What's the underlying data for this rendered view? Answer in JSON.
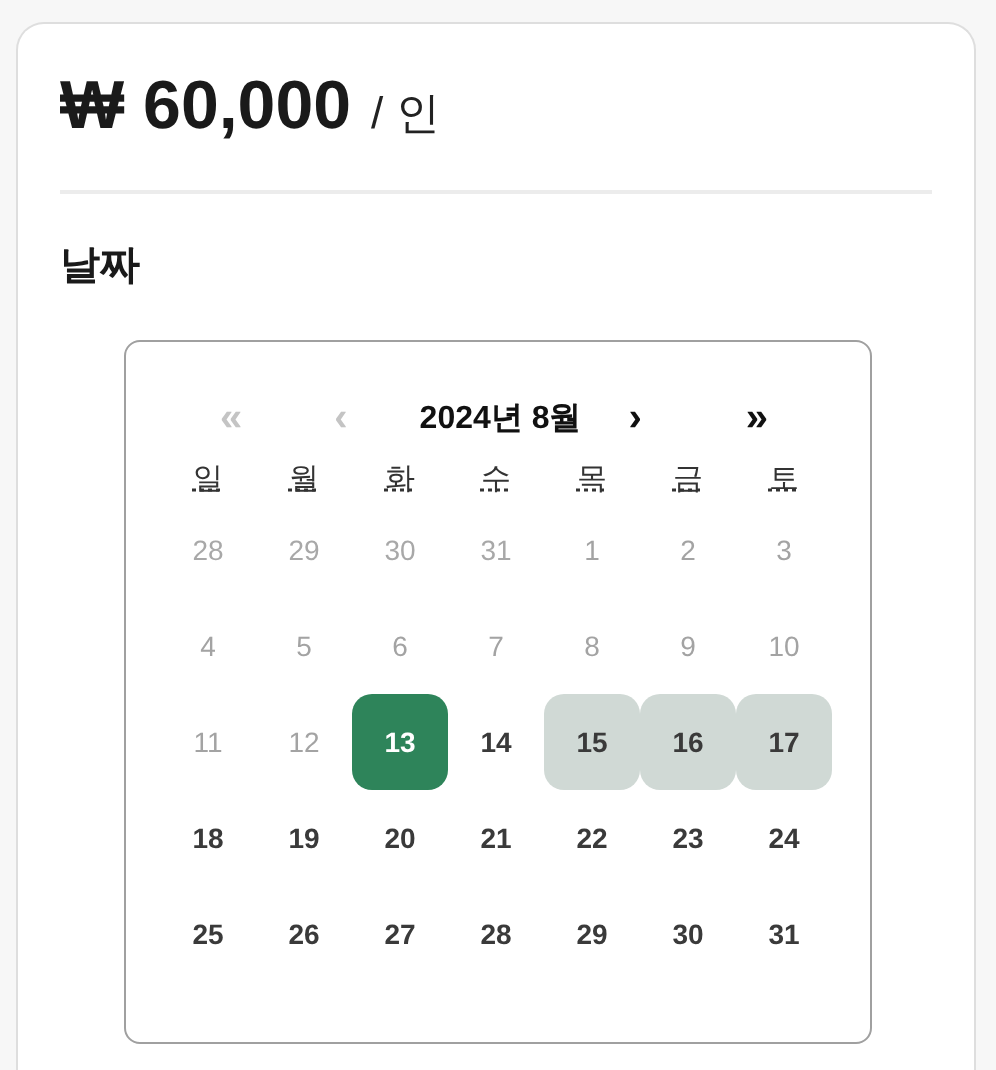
{
  "price": {
    "amount": "₩ 60,000",
    "unit": "/ 인"
  },
  "date_section": {
    "title": "날짜"
  },
  "calendar": {
    "nav": [
      {
        "label": "«",
        "disabled": true
      },
      {
        "label": "‹",
        "disabled": true
      },
      {
        "label": "›",
        "disabled": false
      },
      {
        "label": "»",
        "disabled": false
      }
    ],
    "month_title": "2024년 8월",
    "weekdays": [
      "일",
      "월",
      "화",
      "수",
      "목",
      "금",
      "토"
    ],
    "days": [
      {
        "label": "28",
        "kind": "other",
        "selected": false,
        "in_range": false
      },
      {
        "label": "29",
        "kind": "other",
        "selected": false,
        "in_range": false
      },
      {
        "label": "30",
        "kind": "other",
        "selected": false,
        "in_range": false
      },
      {
        "label": "31",
        "kind": "other",
        "selected": false,
        "in_range": false
      },
      {
        "label": "1",
        "kind": "past",
        "selected": false,
        "in_range": false
      },
      {
        "label": "2",
        "kind": "past",
        "selected": false,
        "in_range": false
      },
      {
        "label": "3",
        "kind": "past",
        "selected": false,
        "in_range": false
      },
      {
        "label": "4",
        "kind": "past",
        "selected": false,
        "in_range": false
      },
      {
        "label": "5",
        "kind": "past",
        "selected": false,
        "in_range": false
      },
      {
        "label": "6",
        "kind": "past",
        "selected": false,
        "in_range": false
      },
      {
        "label": "7",
        "kind": "past",
        "selected": false,
        "in_range": false
      },
      {
        "label": "8",
        "kind": "past",
        "selected": false,
        "in_range": false
      },
      {
        "label": "9",
        "kind": "past",
        "selected": false,
        "in_range": false
      },
      {
        "label": "10",
        "kind": "past",
        "selected": false,
        "in_range": false
      },
      {
        "label": "11",
        "kind": "past",
        "selected": false,
        "in_range": false
      },
      {
        "label": "12",
        "kind": "past",
        "selected": false,
        "in_range": false
      },
      {
        "label": "13",
        "kind": "available",
        "selected": true,
        "in_range": false
      },
      {
        "label": "14",
        "kind": "available",
        "selected": false,
        "in_range": false
      },
      {
        "label": "15",
        "kind": "available",
        "selected": false,
        "in_range": true
      },
      {
        "label": "16",
        "kind": "available",
        "selected": false,
        "in_range": true
      },
      {
        "label": "17",
        "kind": "available",
        "selected": false,
        "in_range": true
      },
      {
        "label": "18",
        "kind": "available",
        "selected": false,
        "in_range": false
      },
      {
        "label": "19",
        "kind": "available",
        "selected": false,
        "in_range": false
      },
      {
        "label": "20",
        "kind": "available",
        "selected": false,
        "in_range": false
      },
      {
        "label": "21",
        "kind": "available",
        "selected": false,
        "in_range": false
      },
      {
        "label": "22",
        "kind": "available",
        "selected": false,
        "in_range": false
      },
      {
        "label": "23",
        "kind": "available",
        "selected": false,
        "in_range": false
      },
      {
        "label": "24",
        "kind": "available",
        "selected": false,
        "in_range": false
      },
      {
        "label": "25",
        "kind": "available",
        "selected": false,
        "in_range": false
      },
      {
        "label": "26",
        "kind": "available",
        "selected": false,
        "in_range": false
      },
      {
        "label": "27",
        "kind": "available",
        "selected": false,
        "in_range": false
      },
      {
        "label": "28",
        "kind": "available",
        "selected": false,
        "in_range": false
      },
      {
        "label": "29",
        "kind": "available",
        "selected": false,
        "in_range": false
      },
      {
        "label": "30",
        "kind": "available",
        "selected": false,
        "in_range": false
      },
      {
        "label": "31",
        "kind": "available",
        "selected": false,
        "in_range": false
      }
    ]
  }
}
